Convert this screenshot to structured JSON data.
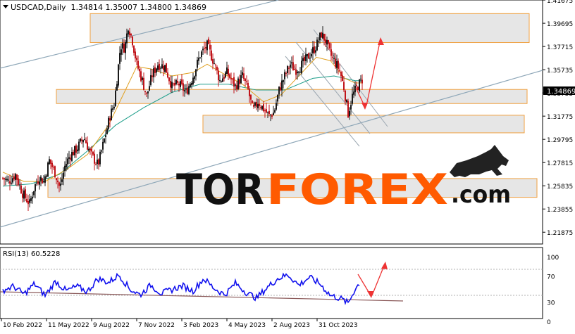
{
  "header": {
    "symbol_line": "USDCAD,Daily  1.34814 1.35007 1.34800 1.34869"
  },
  "rsi_header": "RSI(13) 60.5228",
  "watermark": {
    "brand_dark": "TOR",
    "brand_accent": "FOREX",
    "brand_suffix": ".com"
  },
  "price_labels": [
    "1.41675",
    "1.39695",
    "1.37715",
    "1.35735",
    "1.33755",
    "1.31775",
    "1.29795",
    "1.27815",
    "1.25835",
    "1.23855",
    "1.21875"
  ],
  "current_price": "1.34869",
  "rsi_labels": [
    "100",
    "70",
    "30",
    "0"
  ],
  "date_labels": [
    "10 Feb 2022",
    "11 May 2022",
    "9 Aug 2022",
    "7 Nov 2022",
    "3 Feb 2023",
    "4 May 2023",
    "2 Aug 2023",
    "31 Oct 2023"
  ],
  "colors": {
    "bull": "#1a1a1a",
    "bear": "#c0141a",
    "ma_fast": "#e0a020",
    "ma_slow": "#1e9e8a",
    "rsi": "#1010ee",
    "zone_fill": "#e6e6e6",
    "zone_border": "#f0a040",
    "channel": "#8ea7b8",
    "arrow": "#ee3333",
    "brand_dark": "#111111",
    "brand_accent": "#ff5a00"
  },
  "chart_data": [
    {
      "type": "candlestick",
      "symbol": "USDCAD",
      "timeframe": "Daily",
      "last_bar": {
        "open": 1.34814,
        "high": 1.35007,
        "low": 1.348,
        "close": 1.34869
      },
      "ylim": [
        1.2087,
        1.4168
      ],
      "x_tick_labels": [
        "10 Feb 2022",
        "11 May 2022",
        "9 Aug 2022",
        "7 Nov 2022",
        "3 Feb 2023",
        "4 May 2023",
        "2 Aug 2023",
        "31 Oct 2023"
      ],
      "y_tick_labels": [
        1.41675,
        1.39695,
        1.37715,
        1.35735,
        1.33755,
        1.31775,
        1.29795,
        1.27815,
        1.25835,
        1.23855,
        1.21875
      ],
      "close_path": [
        [
          0,
          1.265
        ],
        [
          8,
          1.262
        ],
        [
          18,
          1.268
        ],
        [
          28,
          1.252
        ],
        [
          38,
          1.243
        ],
        [
          45,
          1.258
        ],
        [
          52,
          1.266
        ],
        [
          58,
          1.262
        ],
        [
          66,
          1.28
        ],
        [
          75,
          1.268
        ],
        [
          81,
          1.256
        ],
        [
          88,
          1.275
        ],
        [
          95,
          1.284
        ],
        [
          105,
          1.29
        ],
        [
          115,
          1.3
        ],
        [
          125,
          1.285
        ],
        [
          135,
          1.276
        ],
        [
          145,
          1.3
        ],
        [
          152,
          1.318
        ],
        [
          158,
          1.328
        ],
        [
          163,
          1.355
        ],
        [
          167,
          1.378
        ],
        [
          173,
          1.376
        ],
        [
          178,
          1.395
        ],
        [
          184,
          1.382
        ],
        [
          190,
          1.362
        ],
        [
          198,
          1.348
        ],
        [
          204,
          1.335
        ],
        [
          212,
          1.353
        ],
        [
          220,
          1.362
        ],
        [
          230,
          1.36
        ],
        [
          240,
          1.343
        ],
        [
          250,
          1.345
        ],
        [
          260,
          1.338
        ],
        [
          270,
          1.352
        ],
        [
          280,
          1.37
        ],
        [
          290,
          1.378
        ],
        [
          300,
          1.363
        ],
        [
          308,
          1.348
        ],
        [
          318,
          1.355
        ],
        [
          330,
          1.343
        ],
        [
          340,
          1.352
        ],
        [
          348,
          1.34
        ],
        [
          355,
          1.322
        ],
        [
          362,
          1.33
        ],
        [
          370,
          1.324
        ],
        [
          378,
          1.318
        ],
        [
          385,
          1.321
        ],
        [
          392,
          1.34
        ],
        [
          400,
          1.352
        ],
        [
          408,
          1.362
        ],
        [
          415,
          1.357
        ],
        [
          422,
          1.36
        ],
        [
          430,
          1.366
        ],
        [
          438,
          1.372
        ],
        [
          445,
          1.378
        ],
        [
          452,
          1.388
        ],
        [
          458,
          1.382
        ],
        [
          465,
          1.37
        ],
        [
          472,
          1.363
        ],
        [
          478,
          1.357
        ],
        [
          484,
          1.342
        ],
        [
          490,
          1.32
        ],
        [
          496,
          1.335
        ],
        [
          503,
          1.343
        ],
        [
          510,
          1.349
        ]
      ],
      "ma_fast_path": [
        [
          0,
          1.27
        ],
        [
          30,
          1.262
        ],
        [
          60,
          1.262
        ],
        [
          90,
          1.272
        ],
        [
          120,
          1.285
        ],
        [
          150,
          1.31
        ],
        [
          170,
          1.335
        ],
        [
          190,
          1.36
        ],
        [
          210,
          1.358
        ],
        [
          240,
          1.352
        ],
        [
          270,
          1.355
        ],
        [
          290,
          1.362
        ],
        [
          310,
          1.355
        ],
        [
          340,
          1.345
        ],
        [
          370,
          1.33
        ],
        [
          395,
          1.336
        ],
        [
          420,
          1.352
        ],
        [
          445,
          1.368
        ],
        [
          465,
          1.365
        ],
        [
          485,
          1.35
        ],
        [
          500,
          1.346
        ],
        [
          510,
          1.346
        ]
      ],
      "ma_slow_path": [
        [
          0,
          1.258
        ],
        [
          40,
          1.26
        ],
        [
          80,
          1.268
        ],
        [
          120,
          1.288
        ],
        [
          160,
          1.31
        ],
        [
          200,
          1.325
        ],
        [
          240,
          1.338
        ],
        [
          280,
          1.345
        ],
        [
          320,
          1.345
        ],
        [
          360,
          1.34
        ],
        [
          400,
          1.34
        ],
        [
          440,
          1.35
        ],
        [
          470,
          1.352
        ],
        [
          500,
          1.348
        ],
        [
          510,
          1.348
        ]
      ],
      "resistance_support_zones": [
        [
          1.3805,
          1.4052
        ],
        [
          1.3285,
          1.3405
        ],
        [
          1.3035,
          1.3185
        ],
        [
          1.2485,
          1.2645
        ]
      ]
    },
    {
      "type": "line",
      "indicator": "RSI",
      "period": 13,
      "current": 60.5228,
      "ylim": [
        0,
        100
      ],
      "levels": [
        30,
        70
      ],
      "x_values": [
        0,
        15,
        30,
        45,
        60,
        75,
        90,
        105,
        120,
        135,
        150,
        165,
        180,
        195,
        210,
        225,
        240,
        255,
        270,
        285,
        300,
        315,
        330,
        345,
        360,
        375,
        390,
        405,
        420,
        435,
        450,
        465,
        480,
        490,
        500,
        507
      ],
      "values": [
        48,
        54,
        42,
        58,
        40,
        62,
        47,
        54,
        46,
        66,
        60,
        72,
        50,
        41,
        56,
        43,
        49,
        55,
        47,
        66,
        51,
        41,
        59,
        45,
        36,
        52,
        66,
        72,
        56,
        68,
        58,
        40,
        35,
        28,
        50,
        60
      ]
    }
  ]
}
